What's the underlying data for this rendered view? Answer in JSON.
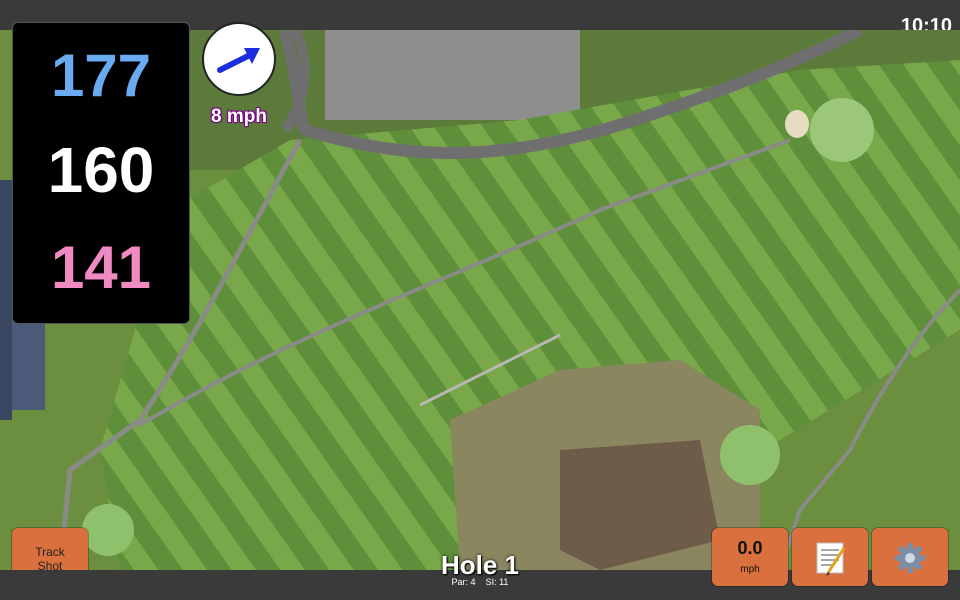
{
  "status": {
    "time": "10:10"
  },
  "distances": {
    "back": "177",
    "middle": "160",
    "front": "141"
  },
  "wind": {
    "speed_label": "8 mph",
    "direction_icon": "arrow-icon"
  },
  "hole": {
    "title": "Hole 1",
    "par_label": "Par: 4",
    "si_label": "SI: 11"
  },
  "buttons": {
    "track_shot_line1": "Track",
    "track_shot_line2": "Shot",
    "wind_value": "0.0",
    "wind_unit": "mph",
    "notes_icon": "notepad-icon",
    "settings_icon": "gear-icon"
  },
  "colors": {
    "button": "#d9703e",
    "back": "#6aaaf0",
    "middle": "#ffffff",
    "front": "#f08ac2",
    "wind_text": "#7a0a86"
  }
}
